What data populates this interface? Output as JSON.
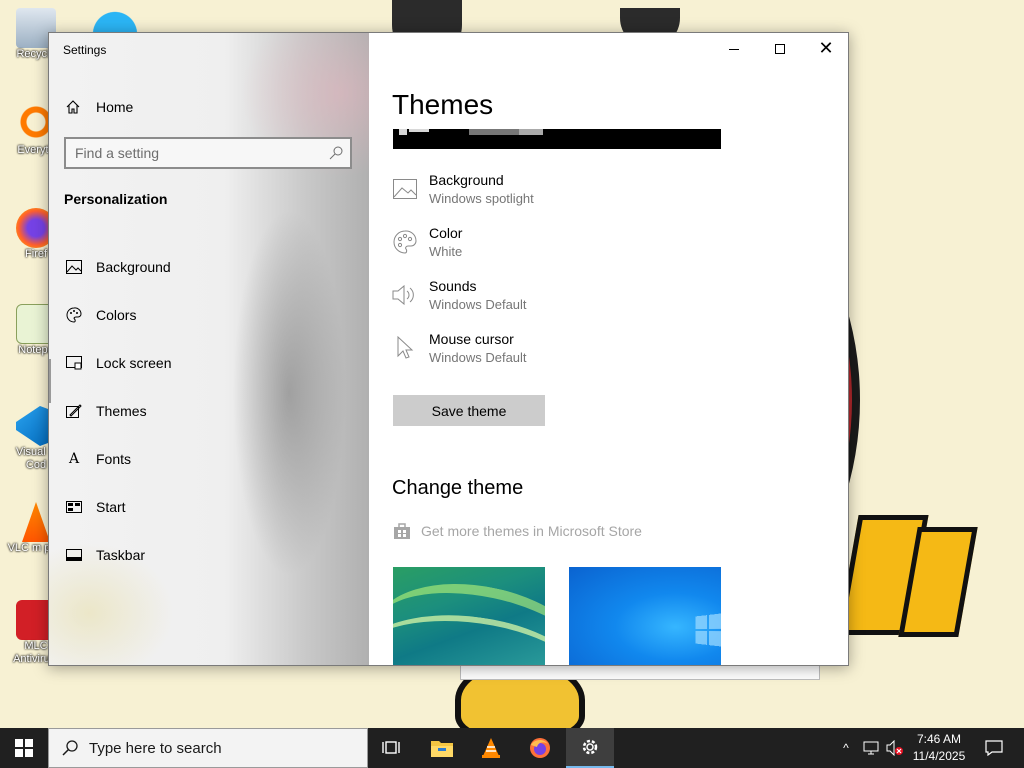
{
  "desktop": {
    "icons": [
      {
        "label": "Recycle",
        "icon": "recycle-bin-icon"
      },
      {
        "label": "Everyth",
        "icon": "everything-search-icon"
      },
      {
        "label": "Firef",
        "icon": "firefox-icon"
      },
      {
        "label": "Notepa",
        "icon": "notepad-icon"
      },
      {
        "label": "Visual S Cod",
        "icon": "vscode-icon"
      },
      {
        "label": "VLC m play",
        "icon": "vlc-icon"
      },
      {
        "label": "MLC Antiviru...",
        "icon": "antivirus-icon"
      }
    ]
  },
  "window": {
    "title": "Settings",
    "controls": {
      "minimize": "minimize-icon",
      "maximize": "maximize-icon",
      "close": "close-icon",
      "close_glyph": "✕"
    }
  },
  "sidebar": {
    "home_label": "Home",
    "search_placeholder": "Find a setting",
    "section_heading": "Personalization",
    "items": [
      {
        "label": "Background",
        "icon": "image-icon"
      },
      {
        "label": "Colors",
        "icon": "palette-icon"
      },
      {
        "label": "Lock screen",
        "icon": "lock-screen-icon"
      },
      {
        "label": "Themes",
        "icon": "themes-icon",
        "selected": true
      },
      {
        "label": "Fonts",
        "icon": "fonts-icon"
      },
      {
        "label": "Start",
        "icon": "start-icon"
      },
      {
        "label": "Taskbar",
        "icon": "taskbar-icon"
      }
    ],
    "fonts_glyph": "A"
  },
  "main": {
    "title": "Themes",
    "properties": [
      {
        "name": "Background",
        "value": "Windows spotlight",
        "icon": "image-icon"
      },
      {
        "name": "Color",
        "value": "White",
        "icon": "palette-icon"
      },
      {
        "name": "Sounds",
        "value": "Windows Default",
        "icon": "speaker-icon"
      },
      {
        "name": "Mouse cursor",
        "value": "Windows Default",
        "icon": "cursor-icon"
      }
    ],
    "save_button": "Save theme",
    "change_heading": "Change theme",
    "store_link": "Get more themes in Microsoft Store",
    "themes": [
      {
        "name": "theme-windows-aero",
        "accent": "#1c8f7d"
      },
      {
        "name": "theme-windows-10",
        "accent": "#1188ee"
      }
    ]
  },
  "taskbar": {
    "search_placeholder": "Type here to search",
    "apps": [
      "task-view-icon",
      "file-explorer-icon",
      "vlc-icon",
      "firefox-icon",
      "settings-icon"
    ],
    "tray_chevron": "^",
    "time": "7:46 AM",
    "date": "11/4/2025"
  },
  "colors": {
    "taskbar_bg": "#202020",
    "accent": "#0078d7",
    "secondary_text": "#767676",
    "button_bg": "#cccccc"
  }
}
